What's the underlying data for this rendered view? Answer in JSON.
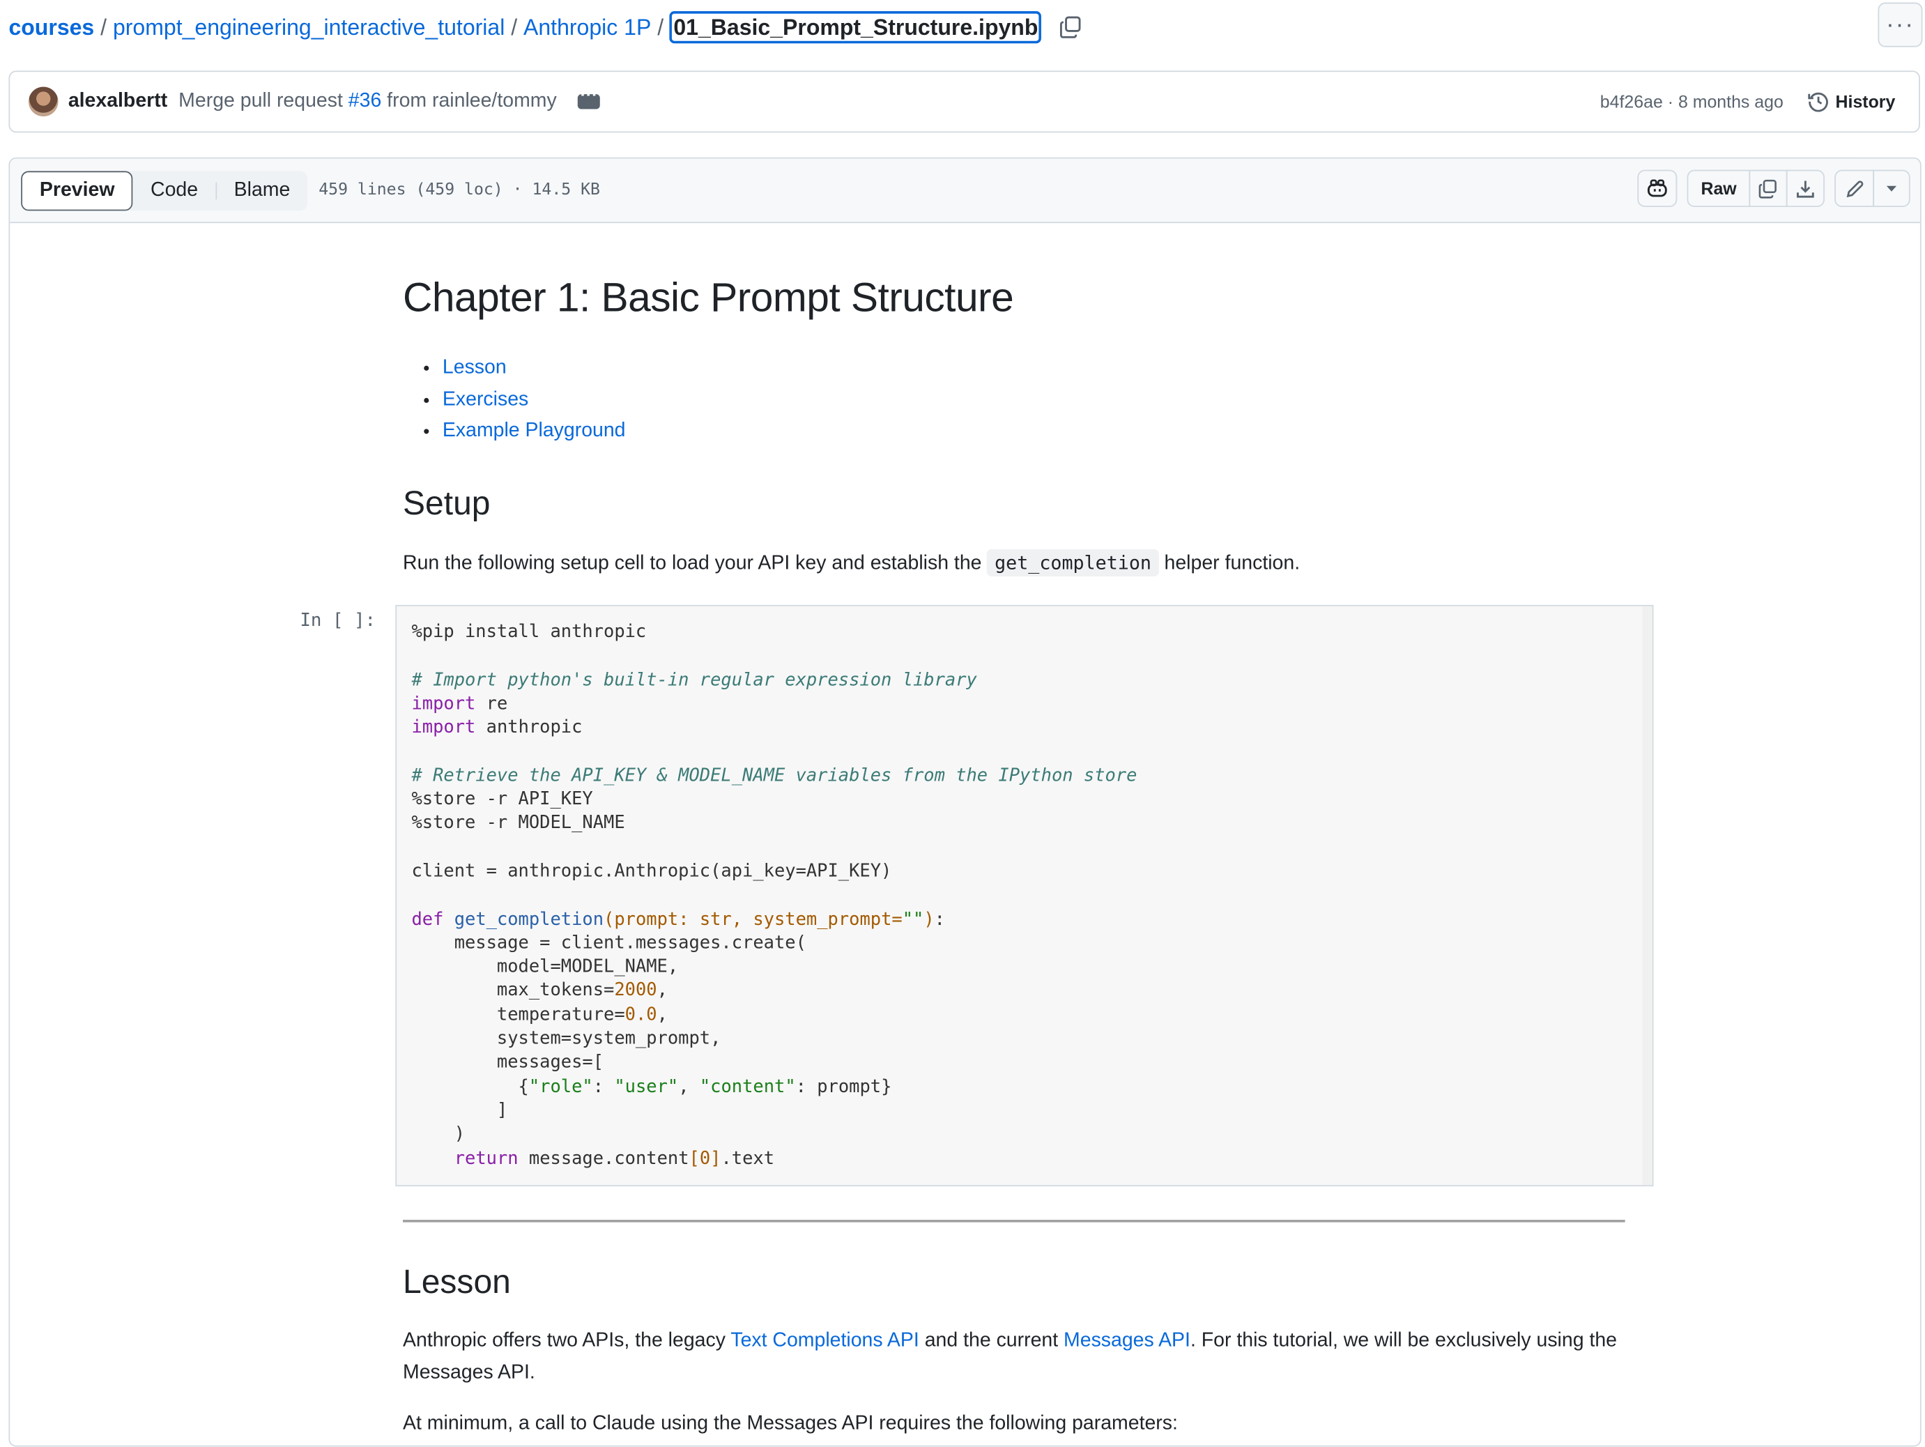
{
  "breadcrumb": {
    "root": "courses",
    "items": [
      "prompt_engineering_interactive_tutorial",
      "Anthropic 1P"
    ],
    "separator": "/",
    "current": "01_Basic_Prompt_Structure.ipynb"
  },
  "commit": {
    "author": "alexalbertt",
    "message_prefix": "Merge pull request ",
    "pr_link": "#36",
    "message_suffix": " from rainlee/tommy",
    "sha": "b4f26ae",
    "age": "8 months ago",
    "meta_sep": " · ",
    "history_label": "History"
  },
  "file_header": {
    "tabs": [
      "Preview",
      "Code",
      "Blame"
    ],
    "active_tab": "Preview",
    "info": "459 lines (459 loc) · 14.5 KB",
    "raw_label": "Raw"
  },
  "notebook": {
    "title": "Chapter 1: Basic Prompt Structure",
    "toc": [
      "Lesson",
      "Exercises",
      "Example Playground"
    ],
    "setup_heading": "Setup",
    "setup_text_before": "Run the following setup cell to load your API key and establish the ",
    "setup_code": "get_completion",
    "setup_text_after": " helper function.",
    "cell_prompt": "In [ ]:",
    "lesson_heading": "Lesson",
    "lesson_p1_a": "Anthropic offers two APIs, the legacy ",
    "lesson_link1": "Text Completions API",
    "lesson_p1_b": " and the current ",
    "lesson_link2": "Messages API",
    "lesson_p1_c": ". For this tutorial, we will be exclusively using the Messages API.",
    "lesson_p2": "At minimum, a call to Claude using the Messages API requires the following parameters:"
  },
  "colors": {
    "link": "#0969da",
    "keyword": "#8a1fa8",
    "comment": "#3b7b76",
    "string": "#1a7f1a",
    "number": "#a35a00"
  }
}
